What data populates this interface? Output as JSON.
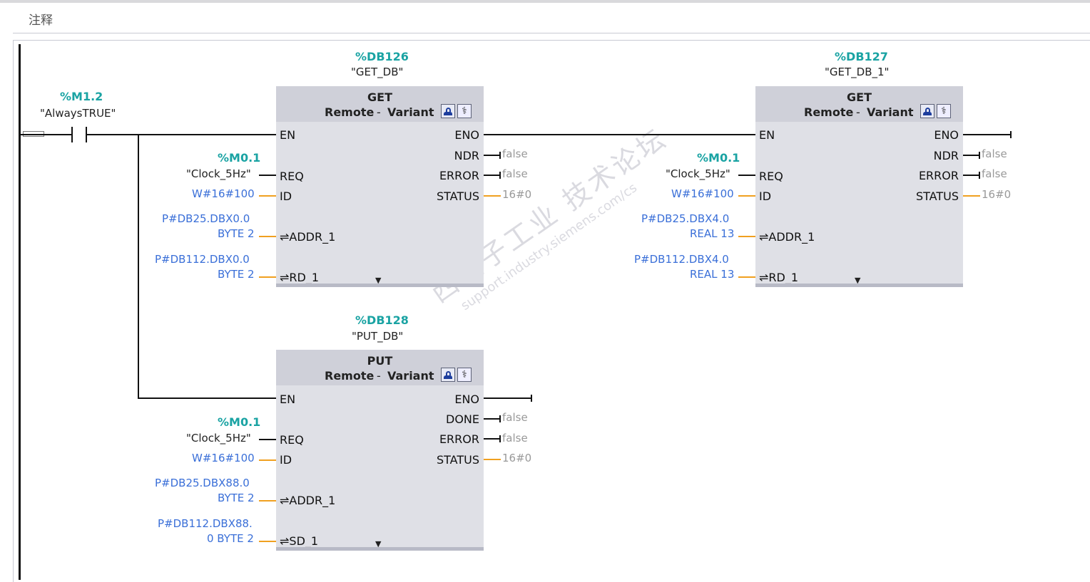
{
  "comment_label": "注释",
  "watermark": {
    "line1": "西门子工业 技术论坛",
    "line2": "support.industry.siemens.com/cs"
  },
  "contact": {
    "address": "%M1.2",
    "symbol": "\"AlwaysTRUE\""
  },
  "icons": {
    "online_diag": "online-diagnostics-icon",
    "properties": "stethoscope-icon",
    "more": "chevron-down-icon"
  },
  "blocks": {
    "get_db": {
      "db_address": "%DB126",
      "db_symbol": "\"GET_DB\"",
      "type": "GET",
      "param_remote": "Remote",
      "param_sep": "-",
      "param_variant": "Variant",
      "in_en": "EN",
      "in_req": "REQ",
      "in_id": "ID",
      "in_addr": "⇌ADDR_1",
      "in_rd": "⇌RD_1",
      "out_eno": "ENO",
      "out_ndr": "NDR",
      "out_error": "ERROR",
      "out_status": "STATUS",
      "req_address": "%M0.1",
      "req_symbol": "\"Clock_5Hz\"",
      "id_value": "W#16#100",
      "addr_line1": "P#DB25.DBX0.0",
      "addr_line2": "BYTE 2",
      "rd_line1": "P#DB112.DBX0.0",
      "rd_line2": "BYTE 2",
      "ndr_value": "false",
      "error_value": "false",
      "status_value": "16#0"
    },
    "get_db_1": {
      "db_address": "%DB127",
      "db_symbol": "\"GET_DB_1\"",
      "type": "GET",
      "param_remote": "Remote",
      "param_sep": "-",
      "param_variant": "Variant",
      "in_en": "EN",
      "in_req": "REQ",
      "in_id": "ID",
      "in_addr": "⇌ADDR_1",
      "in_rd": "⇌RD_1",
      "out_eno": "ENO",
      "out_ndr": "NDR",
      "out_error": "ERROR",
      "out_status": "STATUS",
      "req_address": "%M0.1",
      "req_symbol": "\"Clock_5Hz\"",
      "id_value": "W#16#100",
      "addr_line1": "P#DB25.DBX4.0",
      "addr_line2": "REAL 13",
      "rd_line1": "P#DB112.DBX4.0",
      "rd_line2": "REAL 13",
      "ndr_value": "false",
      "error_value": "false",
      "status_value": "16#0"
    },
    "put_db": {
      "db_address": "%DB128",
      "db_symbol": "\"PUT_DB\"",
      "type": "PUT",
      "param_remote": "Remote",
      "param_sep": "-",
      "param_variant": "Variant",
      "in_en": "EN",
      "in_req": "REQ",
      "in_id": "ID",
      "in_addr": "⇌ADDR_1",
      "in_sd": "⇌SD_1",
      "out_eno": "ENO",
      "out_done": "DONE",
      "out_error": "ERROR",
      "out_status": "STATUS",
      "req_address": "%M0.1",
      "req_symbol": "\"Clock_5Hz\"",
      "id_value": "W#16#100",
      "addr_line1": "P#DB25.DBX88.0",
      "addr_line2": "BYTE 2",
      "sd_line1": "P#DB112.DBX88.",
      "sd_line2": "0 BYTE 2",
      "done_value": "false",
      "error_value": "false",
      "status_value": "16#0"
    }
  }
}
